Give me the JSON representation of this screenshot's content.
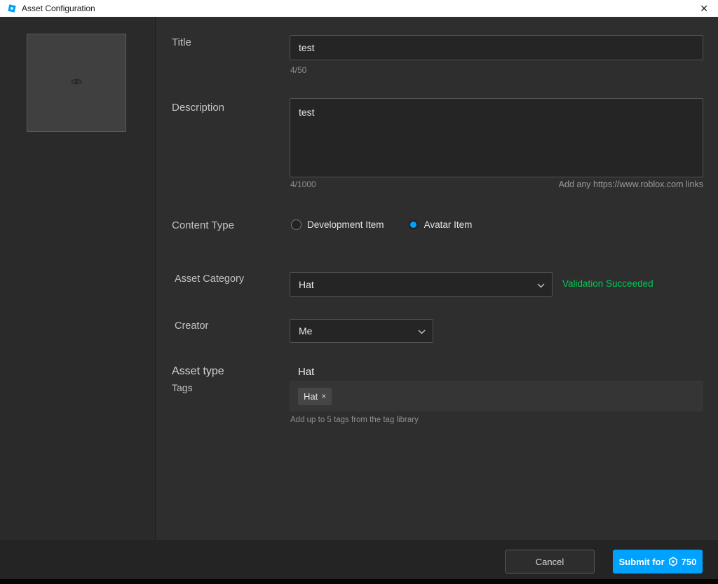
{
  "window": {
    "title": "Asset Configuration",
    "close_glyph": "✕"
  },
  "form": {
    "title": {
      "label": "Title",
      "value": "test",
      "counter": "4/50"
    },
    "description": {
      "label": "Description",
      "value": "test",
      "counter": "4/1000",
      "hint": "Add any https://www.roblox.com links"
    },
    "content_type": {
      "label": "Content Type",
      "options": [
        {
          "label": "Development Item",
          "selected": false
        },
        {
          "label": "Avatar Item",
          "selected": true
        }
      ]
    },
    "asset_category": {
      "label": "Asset Category",
      "value": "Hat",
      "status": "Validation Succeeded"
    },
    "creator": {
      "label": "Creator",
      "value": "Me"
    },
    "asset_type": {
      "label": "Asset type",
      "value": "Hat"
    },
    "tags": {
      "label": "Tags",
      "chips": [
        {
          "label": "Hat"
        }
      ],
      "remove_glyph": "×",
      "hint": "Add up to 5 tags from the tag library"
    }
  },
  "footer": {
    "cancel_label": "Cancel",
    "submit_label": "Submit for",
    "price": "750"
  },
  "colors": {
    "accent": "#00a2ff",
    "success": "#00c853"
  }
}
